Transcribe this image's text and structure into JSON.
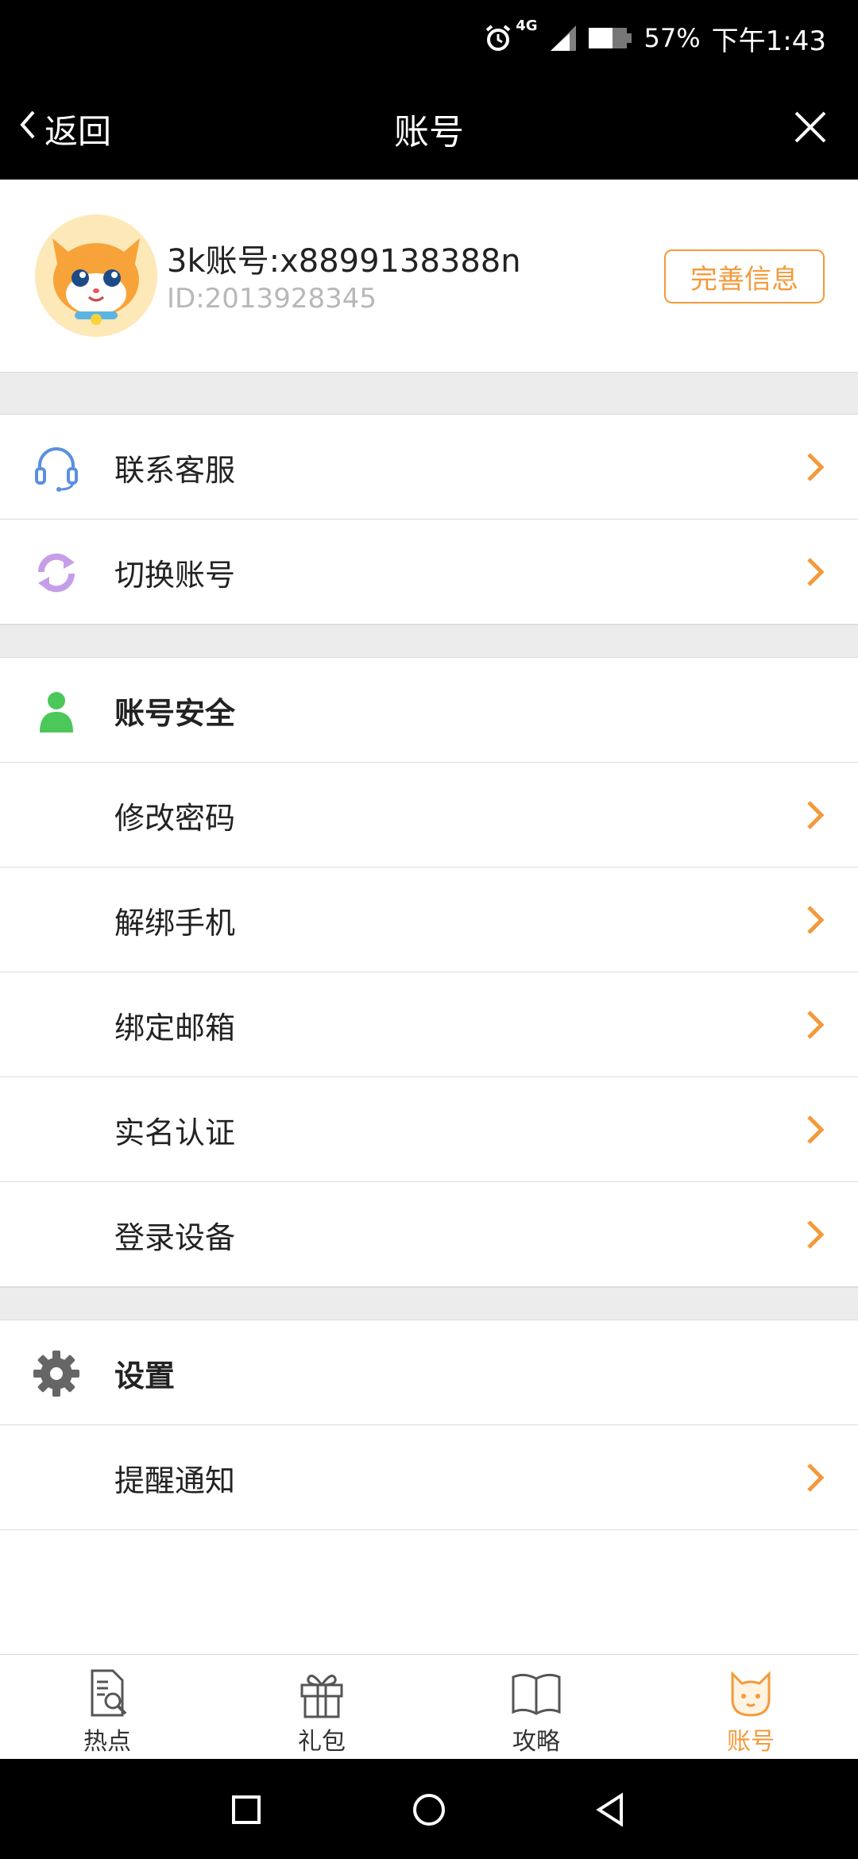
{
  "status_bar": {
    "network": "4G",
    "battery": "57%",
    "time": "下午1:43",
    "icons": [
      "alarm-icon",
      "signal-icon",
      "battery-icon"
    ]
  },
  "header": {
    "back_label": "返回",
    "title": "账号"
  },
  "profile": {
    "account": "3k账号:x8899138388n",
    "id": "ID:2013928345",
    "complete_button": "完善信息"
  },
  "menu": {
    "contact_service": "联系客服",
    "switch_account": "切换账号",
    "security_section": "账号安全",
    "change_password": "修改密码",
    "unbind_phone": "解绑手机",
    "bind_email": "绑定邮箱",
    "real_name": "实名认证",
    "login_devices": "登录设备",
    "settings_section": "设置",
    "notifications": "提醒通知"
  },
  "tabs": [
    {
      "label": "热点",
      "icon": "news-search-icon",
      "active": false
    },
    {
      "label": "礼包",
      "icon": "gift-icon",
      "active": false
    },
    {
      "label": "攻略",
      "icon": "book-icon",
      "active": false
    },
    {
      "label": "账号",
      "icon": "cat-icon",
      "active": true
    }
  ],
  "colors": {
    "accent": "#f39a3b",
    "header_bg": "#000000",
    "section_gap": "#ececec",
    "id_text": "#b8b8b8",
    "headset": "#5b8fe0",
    "switch": "#c69ee8",
    "user": "#4cc75a",
    "gear": "#666666"
  }
}
